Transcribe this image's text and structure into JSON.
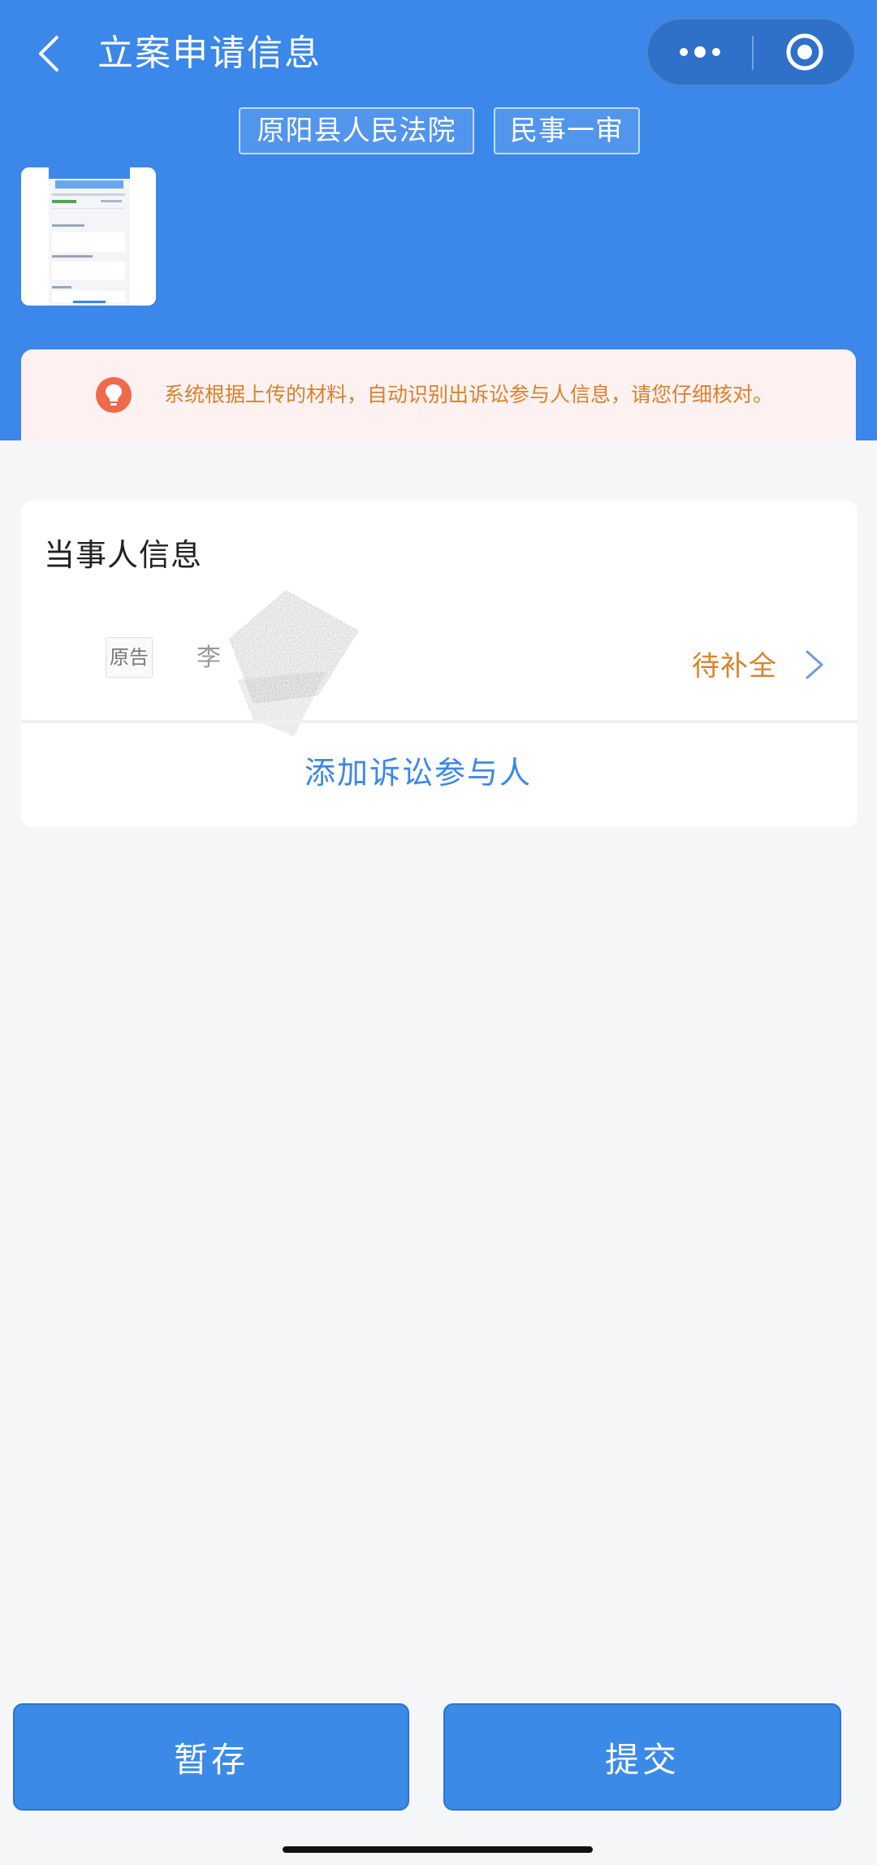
{
  "header": {
    "title": "立案申请信息",
    "court_tag": "原阳县人民法院",
    "case_type_tag": "民事一审"
  },
  "notice": {
    "text": "系统根据上传的材料，自动识别出诉讼参与人信息，请您仔细核对。"
  },
  "party_card": {
    "title": "当事人信息",
    "party": {
      "role": "原告",
      "name": "李",
      "status": "待补全"
    },
    "add_label": "添加诉讼参与人"
  },
  "footer": {
    "save_label": "暂存",
    "submit_label": "提交"
  },
  "colors": {
    "primary": "#3b87ea",
    "warning": "#d9822b",
    "notice_bg": "#fdf1f1"
  }
}
